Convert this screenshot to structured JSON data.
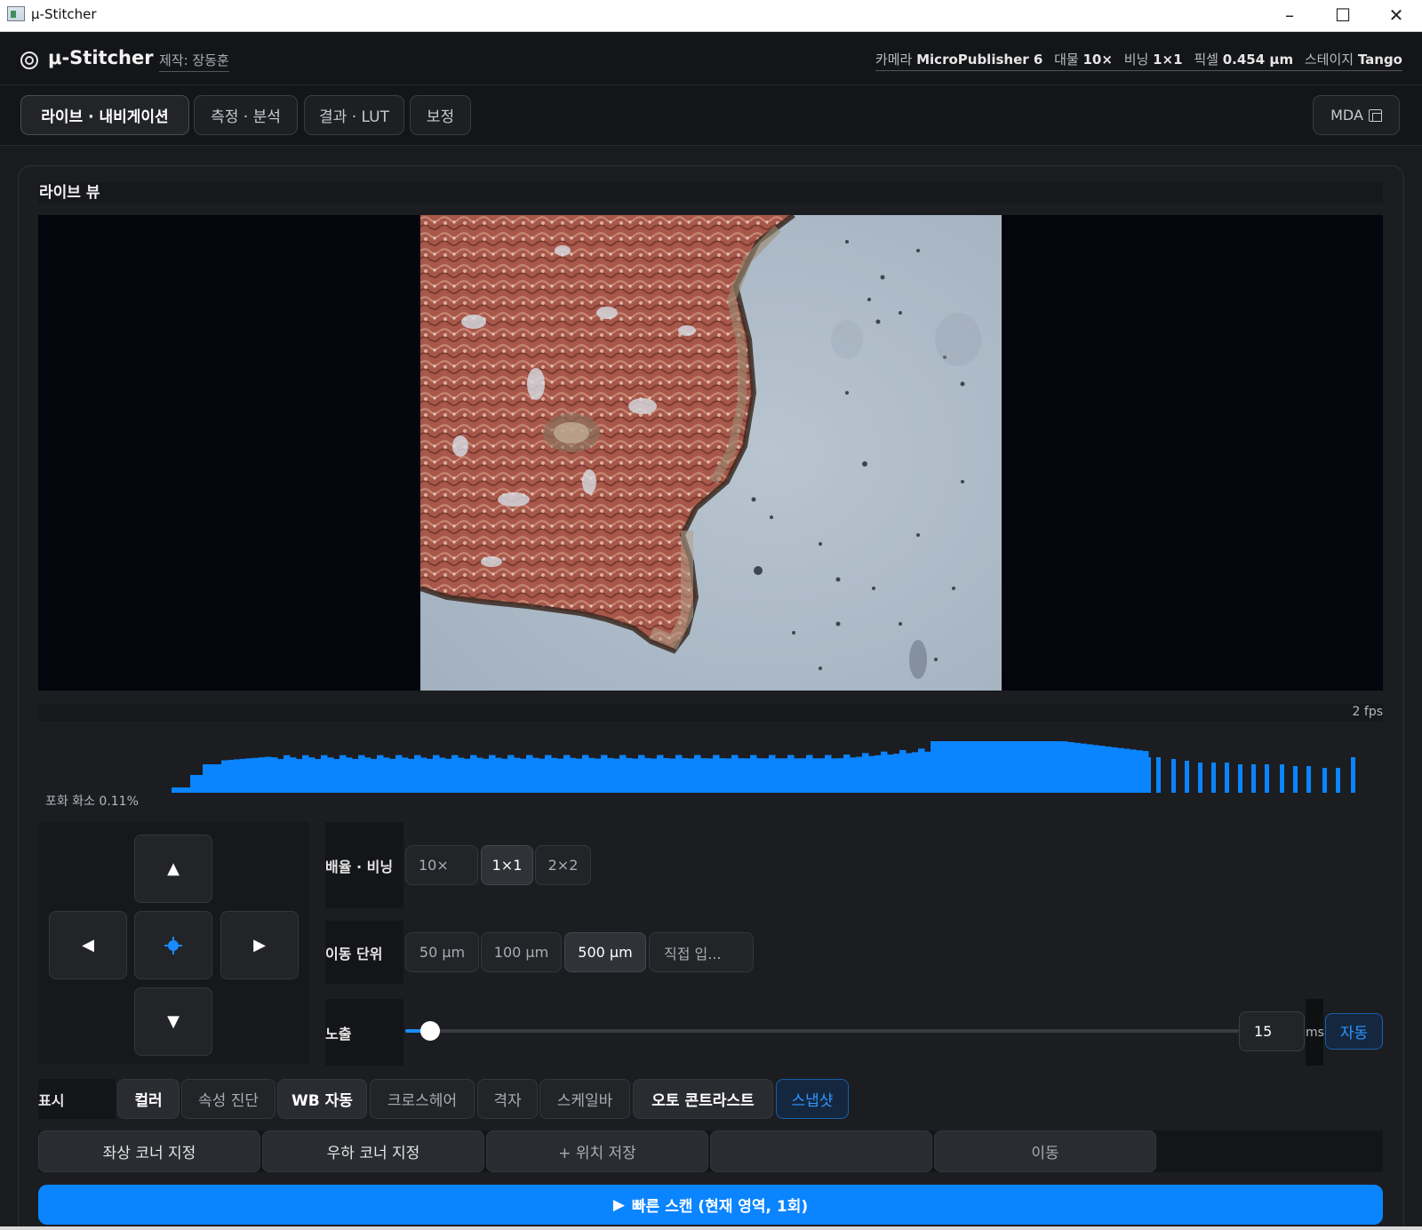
{
  "window": {
    "title": "μ-Stitcher",
    "minimize": "–",
    "maximize": "☐",
    "close": "✕"
  },
  "header": {
    "app_name": "μ-Stitcher",
    "author": "제작: 장동훈",
    "camera_label": "카메라",
    "camera_value": "MicroPublisher 6",
    "objective_label": "대물",
    "objective_value": "10×",
    "binning_label": "비닝",
    "binning_value": "1×1",
    "pixel_label": "픽셀",
    "pixel_value": "0.454 µm",
    "stage_label": "스테이지",
    "stage_value": "Tango"
  },
  "tabs": [
    {
      "label": "라이브 · 내비게이션",
      "active": true
    },
    {
      "label": "측정 · 분석",
      "active": false
    },
    {
      "label": "결과 · LUT",
      "active": false
    },
    {
      "label": "보정",
      "active": false
    }
  ],
  "mda_label": "MDA",
  "live": {
    "title": "라이브 뷰",
    "fps": "2 fps",
    "saturation": "포화 화소 0.11%"
  },
  "joystick": {
    "up": "▲",
    "down": "▼",
    "left": "◀",
    "right": "▶"
  },
  "magnification": {
    "label": "배율 · 비닝",
    "options": [
      {
        "label": "10×",
        "selected": false
      },
      {
        "label": "1×1",
        "selected": true
      },
      {
        "label": "2×2",
        "selected": false
      }
    ]
  },
  "step": {
    "label": "이동 단위",
    "options": [
      {
        "label": "50 µm",
        "selected": false
      },
      {
        "label": "100 µm",
        "selected": false
      },
      {
        "label": "500 µm",
        "selected": true
      }
    ],
    "custom_placeholder": "직접 입..."
  },
  "exposure": {
    "label": "노출",
    "value": "15",
    "unit": "ms",
    "auto_label": "자동",
    "slider_fraction": 0.02
  },
  "display": {
    "label": "표시",
    "options": [
      {
        "label": "컬러",
        "state": "on"
      },
      {
        "label": "속성 진단",
        "state": "off"
      },
      {
        "label": "WB 자동",
        "state": "on-bold"
      },
      {
        "label": "크로스헤어",
        "state": "off"
      },
      {
        "label": "격자",
        "state": "off"
      },
      {
        "label": "스케일바",
        "state": "off"
      },
      {
        "label": "오토 콘트라스트",
        "state": "on-bold"
      },
      {
        "label": "스냅샷",
        "state": "blue"
      }
    ]
  },
  "corners": {
    "top_left": "좌상 코너 지정",
    "bottom_right": "우하 코너 지정",
    "save_position": "+ 위치 저장",
    "empty": "",
    "move": "이동"
  },
  "scan_button": "빠른 스캔 (현재 영역, 1회)",
  "scan_icon": "▶",
  "colors": {
    "accent": "#0a84ff",
    "histogram": "#0a84ff",
    "background": "#1a1b1e"
  }
}
